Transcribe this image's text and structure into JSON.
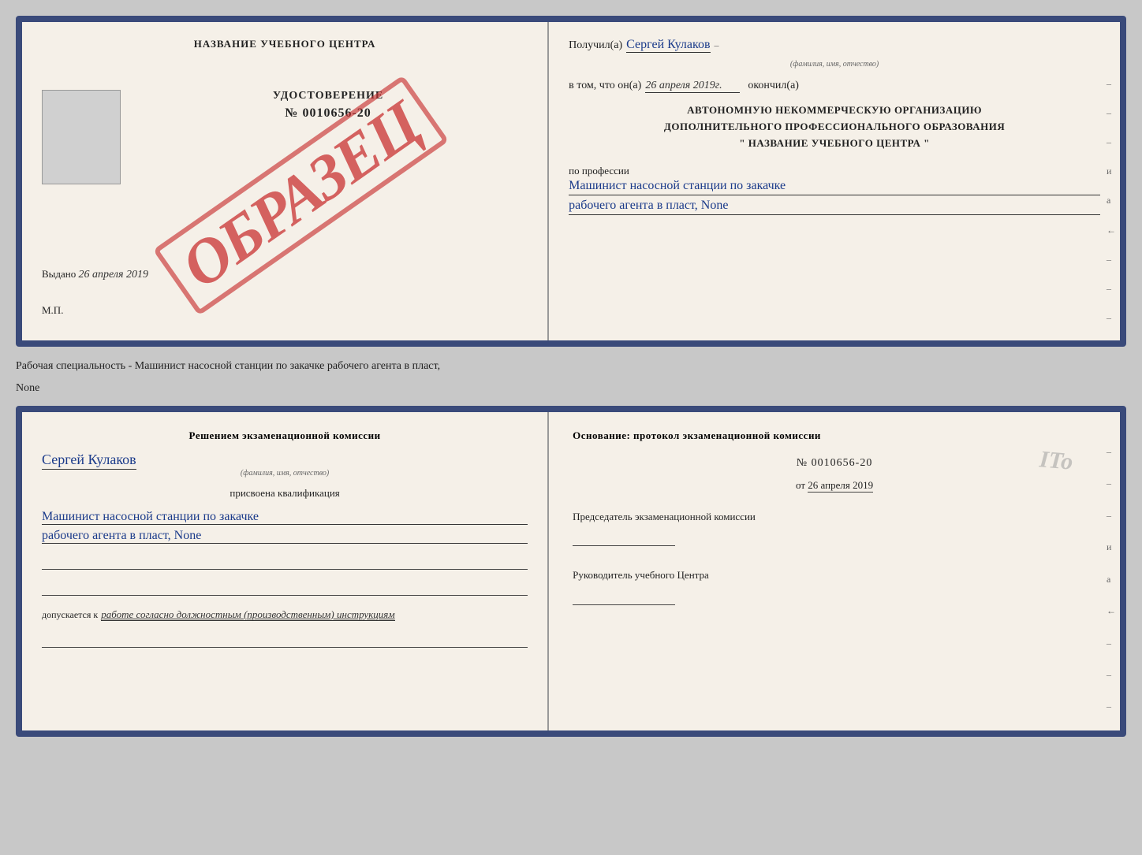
{
  "cert_top": {
    "left": {
      "title": "НАЗВАНИЕ УЧЕБНОГО ЦЕНТРА",
      "obrazets": "ОБРАЗЕЦ",
      "udostoverenie": "УДОСТОВЕРЕНИЕ",
      "number": "№ 0010656-20",
      "vydano": "Выдано",
      "vydano_date": "26 апреля 2019",
      "mp": "М.П."
    },
    "right": {
      "poluchil_label": "Получил(а)",
      "recipient_name": "Сергей Кулаков",
      "recipient_hint": "(фамилия, имя, отчество)",
      "v_tom_chto": "в том, что он(а)",
      "date_value": "26 апреля 2019г.",
      "okonchil": "окончил(а)",
      "org_line1": "АВТОНОМНУЮ НЕКОММЕРЧЕСКУЮ ОРГАНИЗАЦИЮ",
      "org_line2": "ДОПОЛНИТЕЛЬНОГО ПРОФЕССИОНАЛЬНОГО ОБРАЗОВАНИЯ",
      "org_line3": "\"  НАЗВАНИЕ УЧЕБНОГО ЦЕНТРА  \"",
      "po_professii": "по профессии",
      "profession1": "Машинист насосной станции по закачке",
      "profession2": "рабочего агента в пласт, None"
    }
  },
  "caption": {
    "text": "Рабочая специальность - Машинист насосной станции по закачке рабочего агента в пласт,",
    "text2": "None"
  },
  "cert_bottom": {
    "left": {
      "resheniem_title": "Решением экзаменационной комиссии",
      "name": "Сергей Кулаков",
      "name_hint": "(фамилия, имя, отчество)",
      "prisvoena": "присвоена квалификация",
      "kval1": "Машинист насосной станции по закачке",
      "kval2": "рабочего агента в пласт, None",
      "dopusk_label": "допускается к",
      "dopusk_value": "работе согласно должностным (производственным) инструкциям"
    },
    "right": {
      "osnovanie_title": "Основание: протокол экзаменационной комиссии",
      "protocol_number": "№ 0010656-20",
      "protocol_date_prefix": "от",
      "protocol_date": "26 апреля 2019",
      "predsedatel_title": "Председатель экзаменационной комиссии",
      "rukovoditel_title": "Руководитель учебного Центра",
      "ito": "ITo"
    }
  },
  "dashes": {
    "items": [
      "–",
      "–",
      "–",
      "и",
      "а",
      "←",
      "–",
      "–",
      "–"
    ]
  }
}
